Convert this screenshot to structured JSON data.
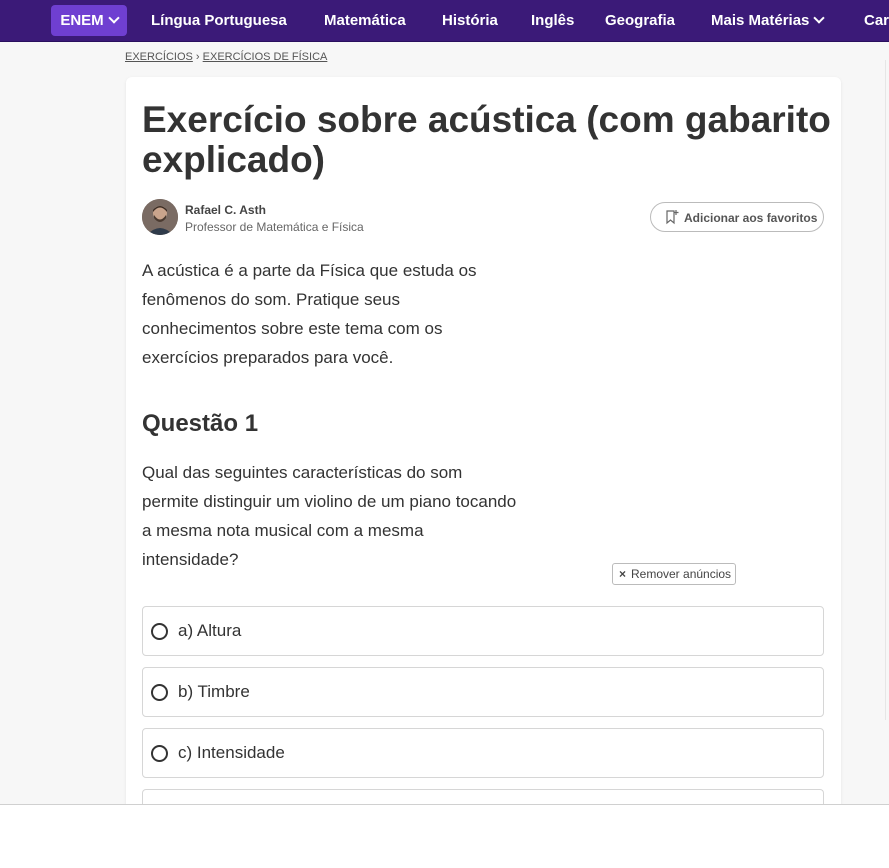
{
  "nav": {
    "enem": "ENEM",
    "items": [
      "Língua Portuguesa",
      "Matemática",
      "História",
      "Inglês",
      "Geografia",
      "Mais Matérias",
      "Car"
    ]
  },
  "breadcrumb": {
    "first": "EXERCÍCIOS",
    "separator": "›",
    "second": "EXERCÍCIOS DE FÍSICA"
  },
  "article": {
    "title": "Exercício sobre acústica (com gabarito explicado)",
    "author": {
      "name": "Rafael C. Asth",
      "role": "Professor de Matemática e Física"
    },
    "favorite_label": "Adicionar aos favoritos",
    "intro": "A acústica é a parte da Física que estuda os fenômenos do som. Pratique seus conhecimentos sobre este tema com os exercícios preparados para você."
  },
  "question": {
    "title": "Questão 1",
    "text": "Qual das seguintes características do som permite distinguir um violino de um piano tocando a mesma nota musical com a mesma intensidade?",
    "options": [
      "a) Altura",
      "b) Timbre",
      "c) Intensidade"
    ]
  },
  "ads": {
    "remove_label": "Remover anúncios",
    "remove_icon": "×"
  },
  "colors": {
    "nav_bg": "#3b1a78",
    "enem_bg": "#6f3fd1"
  }
}
